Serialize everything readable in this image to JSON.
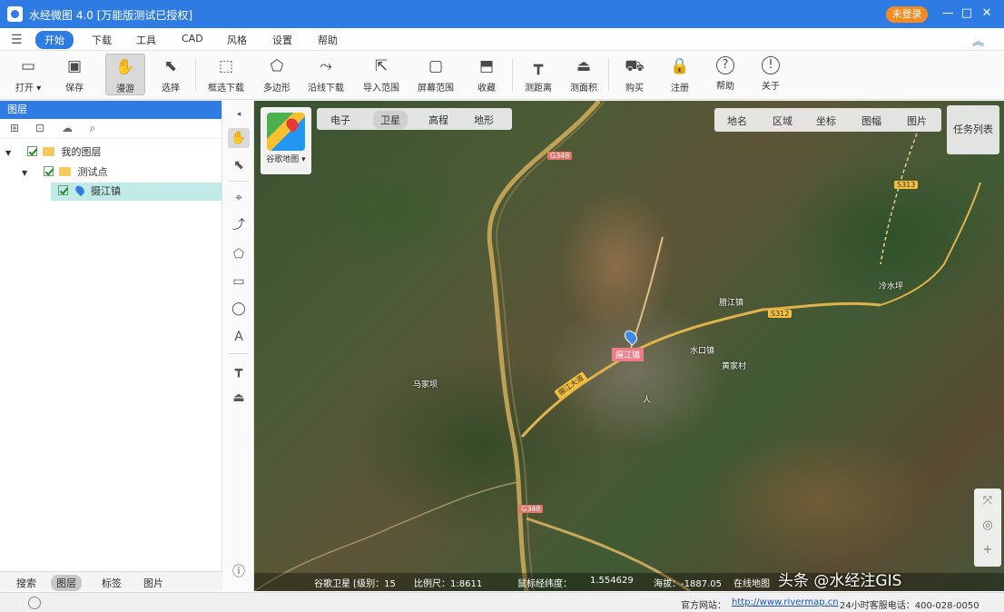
{
  "window": {
    "title": "水经微图 4.0 [万能版测试已授权]",
    "login_label": "未登录",
    "min_icon": "minimize-icon",
    "max_icon": "maximize-icon",
    "close_icon": "close-icon"
  },
  "menu": {
    "items": [
      "开始",
      "下载",
      "工具",
      "CAD",
      "风格",
      "设置",
      "帮助"
    ],
    "active": "开始"
  },
  "toolbar": {
    "tools": [
      {
        "label": "打开 ▾",
        "icon": "folder-icon",
        "glyph": "▭"
      },
      {
        "label": "保存",
        "icon": "save-icon",
        "glyph": "▣"
      },
      {
        "label": "漫游",
        "icon": "hand-icon",
        "glyph": "✋",
        "active": true
      },
      {
        "label": "选择",
        "icon": "select-arrow-icon",
        "glyph": "⬉"
      },
      {
        "label": "框选下载",
        "icon": "rect-download-icon",
        "glyph": "⬚"
      },
      {
        "label": "多边形",
        "icon": "polygon-icon",
        "glyph": "⬠"
      },
      {
        "label": "沿线下载",
        "icon": "line-download-icon",
        "glyph": "⤳"
      },
      {
        "label": "导入范围",
        "icon": "import-range-icon",
        "glyph": "⇱"
      },
      {
        "label": "屏幕范围",
        "icon": "screen-range-icon",
        "glyph": "▢"
      },
      {
        "label": "收藏",
        "icon": "favorite-icon",
        "glyph": "⬒"
      },
      {
        "label": "测距离",
        "icon": "ruler-icon",
        "glyph": "┳"
      },
      {
        "label": "测面积",
        "icon": "area-icon",
        "glyph": "⏏"
      },
      {
        "label": "购买",
        "icon": "cart-icon",
        "glyph": "⛟"
      },
      {
        "label": "注册",
        "icon": "lock-icon",
        "glyph": "🔒"
      },
      {
        "label": "帮助",
        "icon": "help-icon",
        "glyph": "?"
      },
      {
        "label": "关于",
        "icon": "info-icon",
        "glyph": "!"
      }
    ]
  },
  "layers_panel": {
    "header": "图层",
    "tree": [
      {
        "label": "我的图层",
        "level": 0
      },
      {
        "label": "测试点",
        "level": 1
      },
      {
        "label": "摄江镇",
        "level": 2,
        "selected": true
      }
    ],
    "bottom_tabs": [
      "搜索",
      "图层",
      "标签",
      "图片"
    ],
    "active_tab": "图层"
  },
  "map": {
    "badge_label": "谷歌地图 ▾",
    "types": [
      "电子",
      "卫星",
      "高程",
      "地形"
    ],
    "active_type": "卫星",
    "right_tools": [
      "地名",
      "区域",
      "坐标",
      "图幅",
      "图片"
    ],
    "task_list": "任务列表",
    "poi_label": "摄江镇",
    "labels": [
      {
        "text": "冷水坪"
      },
      {
        "text": "腊江镇"
      },
      {
        "text": "水口镇"
      },
      {
        "text": "黄家村"
      },
      {
        "text": "马家坝"
      },
      {
        "text": "人"
      }
    ],
    "road_tags": [
      {
        "text": "G348",
        "style": "red"
      },
      {
        "text": "S313",
        "style": "yellow"
      },
      {
        "text": "S312",
        "style": "yellow"
      },
      {
        "text": "摄江大道",
        "style": "yellow"
      },
      {
        "text": "G348",
        "style": "red"
      }
    ],
    "status": {
      "source": "谷歌卫星 [级别：15",
      "scale": "比例尺：1:8611",
      "coords_label": "鼠标经纬度：",
      "coords": "1.554629",
      "elevation": "海拔：-1887.05",
      "extra": "在线地图"
    },
    "watermark": "头条 @水经注GIS"
  },
  "statusbar": {
    "website_label": "官方网站：",
    "website": "http://www.rivermap.cn",
    "hotline": "24小时客服电话：400-028-0050"
  }
}
